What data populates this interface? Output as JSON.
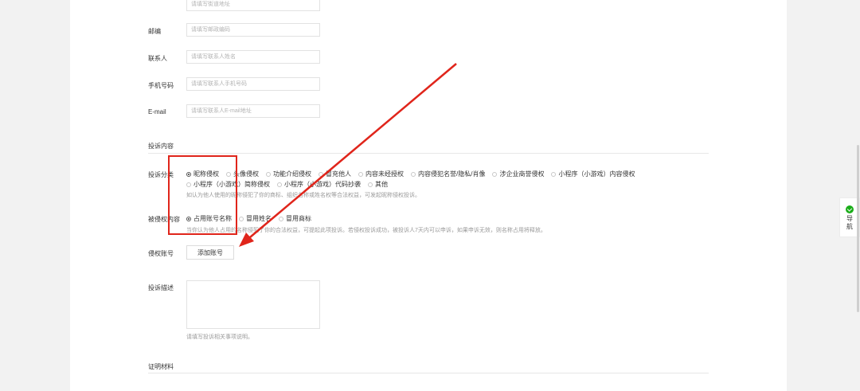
{
  "form": {
    "street_placeholder": "请填写街道地址",
    "postcode": {
      "label": "邮编",
      "placeholder": "请填写邮政编码"
    },
    "contact": {
      "label": "联系人",
      "placeholder": "请填写联系人姓名"
    },
    "phone": {
      "label": "手机号码",
      "placeholder": "请填写联系人手机号码"
    },
    "email": {
      "label": "E-mail",
      "placeholder": "请填写联系人E-mail地址"
    }
  },
  "complaint": {
    "section_title": "投诉内容",
    "category": {
      "label": "投诉分类",
      "options_row1": [
        "昵称侵权",
        "头像侵权",
        "功能介绍侵权",
        "冒充他人",
        "内容未经授权",
        "内容侵犯名誉/隐私/肖像",
        "涉企业商誉侵权",
        "小程序（小游戏）内容侵权"
      ],
      "options_row2": [
        "小程序（小游戏）简称侵权",
        "小程序（小游戏）代码抄袭",
        "其他"
      ],
      "selected": "昵称侵权",
      "hint": "如认为他人使用的昵称侵犯了你的商标、组织名称或姓名权等合法权益，可发起昵称侵权投诉。"
    },
    "infringed": {
      "label": "被侵权内容",
      "options": [
        "占用账号名称",
        "冒用姓名",
        "冒用商标"
      ],
      "selected": "占用账号名称",
      "hint": "当你认为他人占用的名称侵犯了你的合法权益，可提起此项投诉。若侵权投诉成功，被投诉人7天内可以申诉，如果申诉无效，则名称占用将释放。"
    },
    "account": {
      "label": "侵权账号",
      "button": "添加账号"
    },
    "description": {
      "label": "投诉描述",
      "hint": "请填写投诉相关事项说明。"
    }
  },
  "evidence": {
    "section_title": "证明材料"
  },
  "side_nav": {
    "line1": "导",
    "line2": "航",
    "icon": "check-circle-icon"
  },
  "annotation": {
    "color": "#e0251b"
  }
}
